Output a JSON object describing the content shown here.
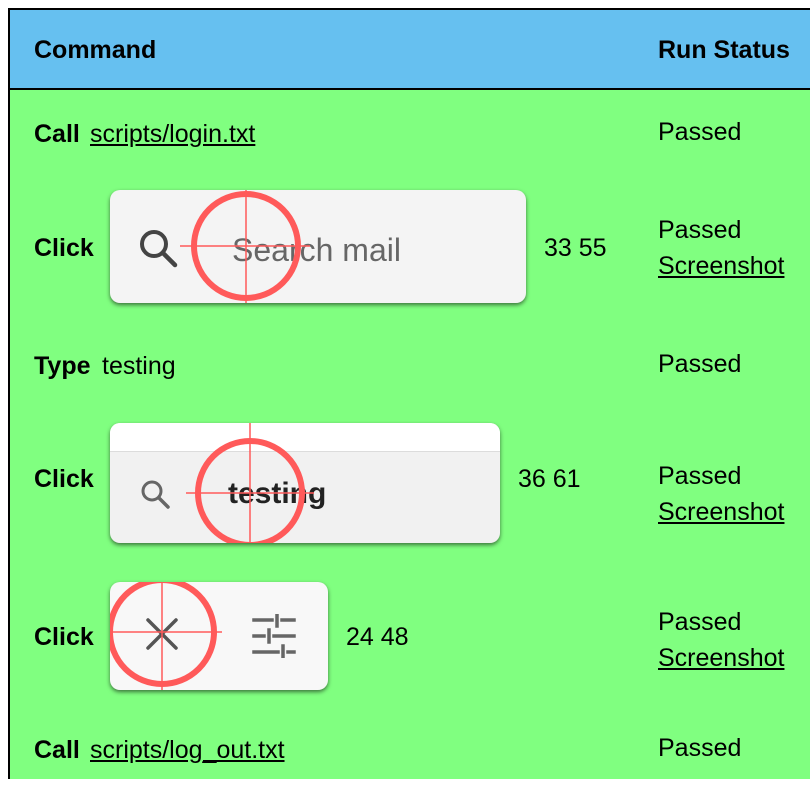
{
  "table": {
    "headers": {
      "command": "Command",
      "status": "Run Status"
    },
    "rows": [
      {
        "command": "Call",
        "argument": "scripts/login.txt",
        "status": "Passed"
      },
      {
        "command": "Click",
        "thumb_text": "Search mail",
        "coordinates": "33 55",
        "status": "Passed",
        "screenshot": "Screenshot"
      },
      {
        "command": "Type",
        "argument": "testing",
        "status": "Passed"
      },
      {
        "command": "Click",
        "thumb_text": "testing",
        "coordinates": "36 61",
        "status": "Passed",
        "screenshot": "Screenshot"
      },
      {
        "command": "Click",
        "coordinates": "24 48",
        "status": "Passed",
        "screenshot": "Screenshot"
      },
      {
        "command": "Call",
        "argument": "scripts/log_out.txt",
        "status": "Passed"
      }
    ]
  },
  "icons": [
    "search-icon",
    "close-icon",
    "tune-icon",
    "target-marker"
  ],
  "colors": {
    "header": "#66c0f0",
    "body": "#80ff80",
    "marker": "#ff5a5a"
  }
}
